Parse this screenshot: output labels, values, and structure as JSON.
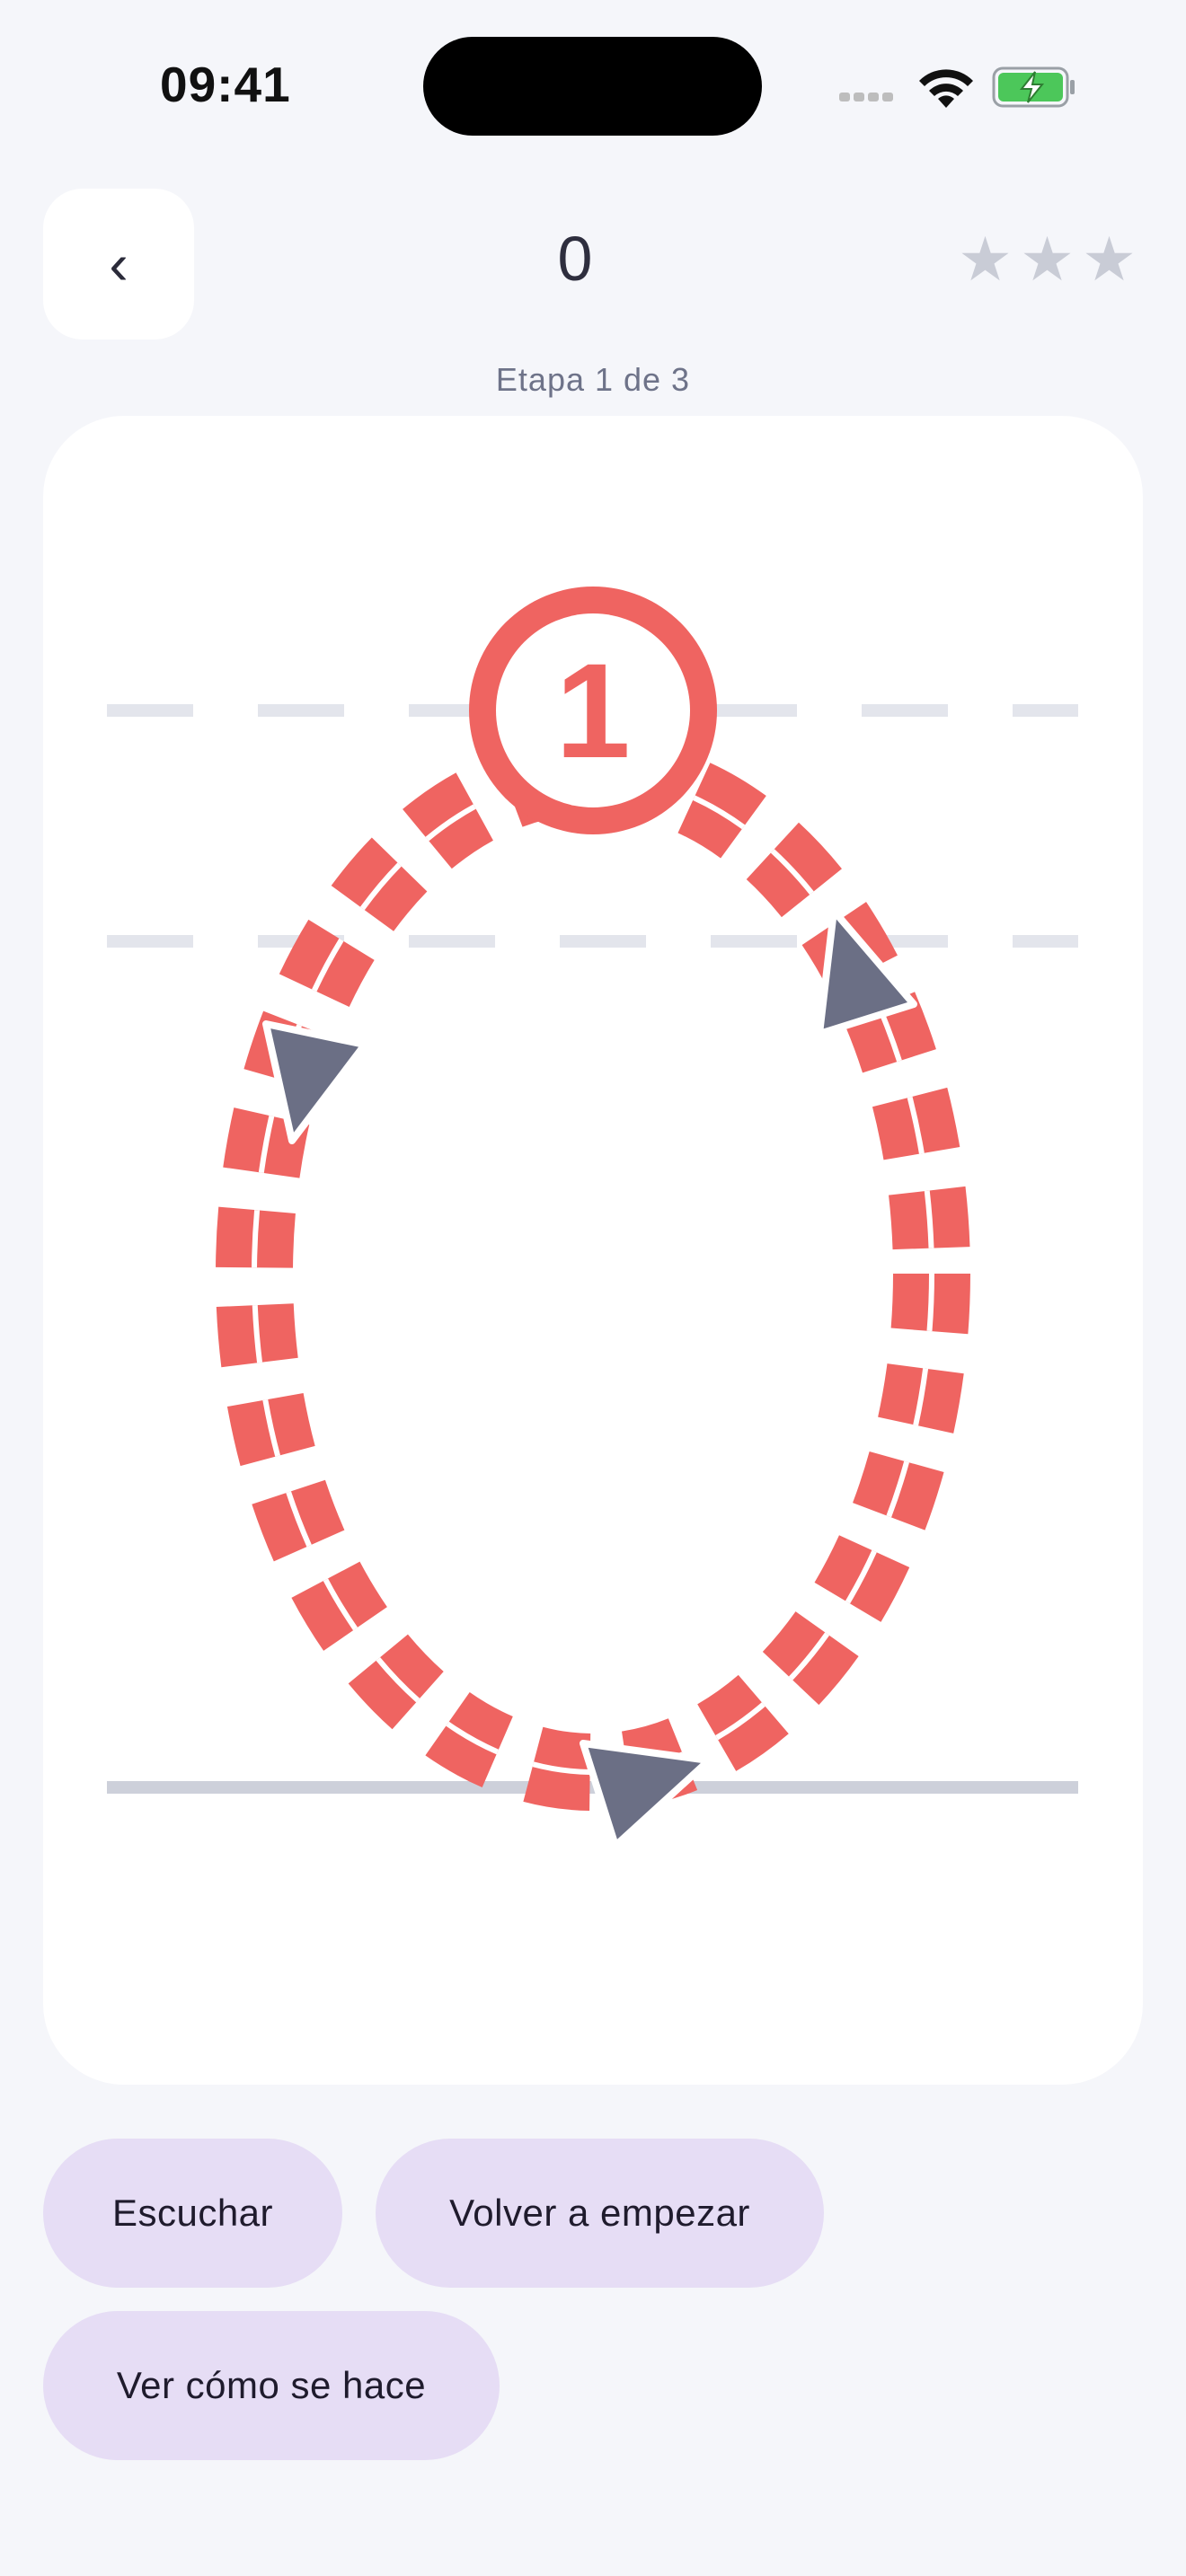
{
  "status_bar": {
    "time": "09:41"
  },
  "header": {
    "back_label": "‹",
    "score": "0",
    "stars_total": 3,
    "stars_earned": 0,
    "star_glyph": "★"
  },
  "stage_label": "Etapa 1 de 3",
  "tracing": {
    "letter": "o",
    "stroke_number": "1",
    "accent_color": "#EF6461",
    "arrow_color": "#6B6F85",
    "guide_color": "#E3E5EC",
    "baseline_color": "#CDD0DA"
  },
  "actions": {
    "listen": "Escuchar",
    "restart": "Volver a empezar",
    "demo": "Ver cómo se hace"
  }
}
